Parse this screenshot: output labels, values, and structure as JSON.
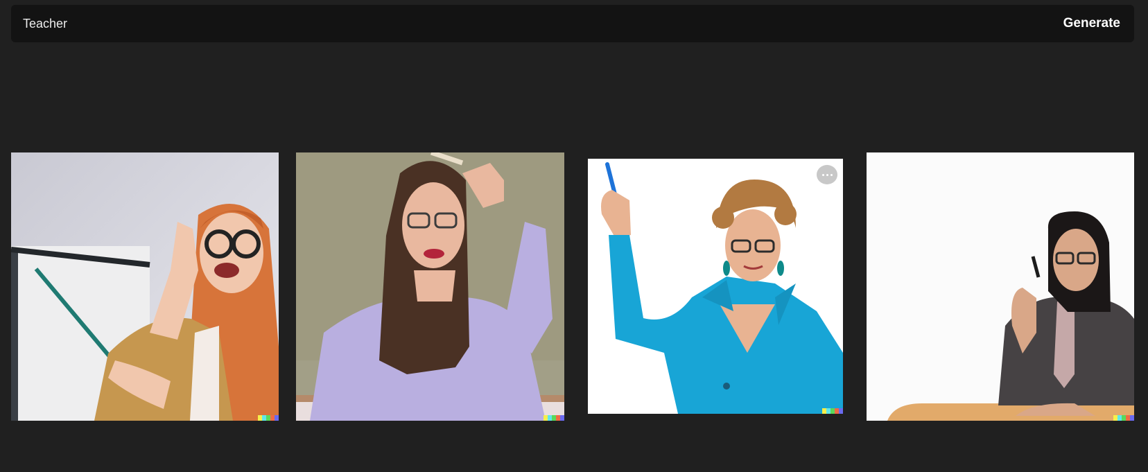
{
  "prompt_bar": {
    "input_value": "Teacher",
    "generate_label": "Generate"
  },
  "gallery": {
    "images": [
      {
        "description_icon": "teacher-redhead-pointer-image"
      },
      {
        "description_icon": "teacher-brunette-lavender-shirt-image"
      },
      {
        "description_icon": "teacher-blue-jacket-raised-marker-image"
      },
      {
        "description_icon": "teacher-dark-blazer-pen-image"
      }
    ],
    "signature_colors": [
      "#f6ef4a",
      "#5fe7e9",
      "#5ad95a",
      "#ef6a46",
      "#6a6af0"
    ]
  }
}
